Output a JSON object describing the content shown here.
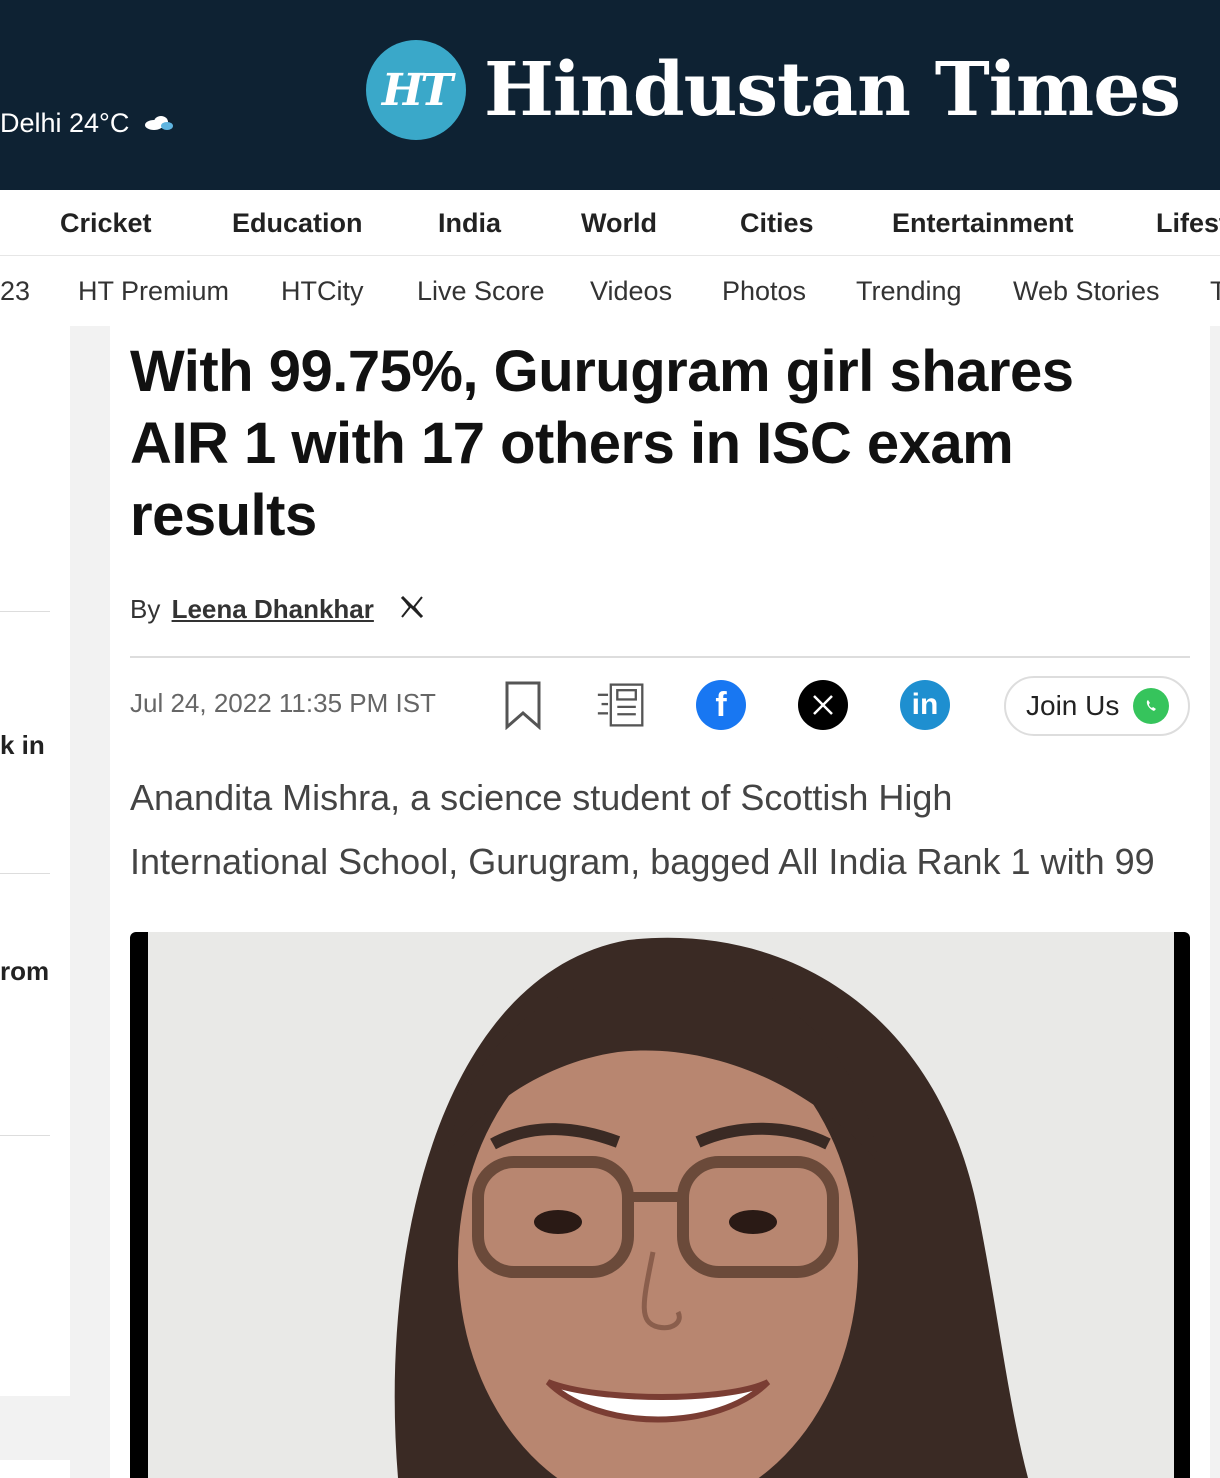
{
  "header": {
    "weather": "Delhi 24°C",
    "logo_badge": "HT",
    "logo_text": "Hindustan Times"
  },
  "nav_primary": [
    "Cricket",
    "Education",
    "India",
    "World",
    "Cities",
    "Entertainment",
    "Lifest"
  ],
  "nav_secondary": [
    "23",
    "HT Premium",
    "HTCity",
    "Live Score",
    "Videos",
    "Photos",
    "Trending",
    "Web Stories",
    "T"
  ],
  "left_rail": {
    "fragments": [
      "k in",
      "rom"
    ]
  },
  "article": {
    "headline": "With 99.75%, Gurugram girl shares AIR 1 with 17 others in ISC exam results",
    "by_label": "By",
    "author": "Leena Dhankhar",
    "date": "Jul 24, 2022 11:35 PM IST",
    "join_label": "Join Us",
    "summary_lines": [
      "Anandita Mishra, a science student of Scottish High",
      "International School, Gurugram, bagged All India Rank 1 with 99"
    ]
  },
  "colors": {
    "header_bg": "#0e2233",
    "logo_badge": "#3aa8c9",
    "facebook": "#1877f2",
    "linkedin": "#1e8fd0",
    "whatsapp": "#36c45c"
  },
  "icons": [
    "cloud-icon",
    "x-icon",
    "bookmark-icon",
    "text-size-icon",
    "facebook-icon",
    "linkedin-icon",
    "whatsapp-icon"
  ]
}
